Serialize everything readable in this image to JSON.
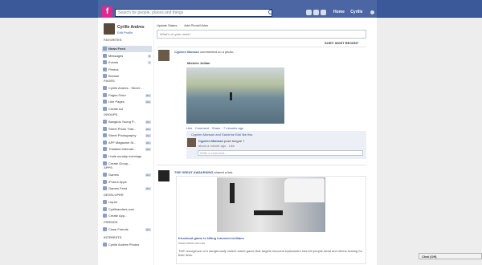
{
  "header": {
    "search_placeholder": "Search for people, places and things",
    "home": "Home",
    "user": "Cyrille"
  },
  "profile": {
    "name": "Cyrille Andres",
    "edit": "Edit Profile"
  },
  "sections": {
    "favorites": "FAVORITES",
    "pages": "PAGES",
    "groups": "GROUPS",
    "apps": "APPS",
    "developer": "DEVELOPER",
    "friends": "FRIENDS",
    "interests": "INTERESTS"
  },
  "favorites": [
    {
      "label": "News Feed",
      "badge": ""
    },
    {
      "label": "Messages",
      "badge": "9"
    },
    {
      "label": "Events",
      "badge": "7"
    },
    {
      "label": "Photos",
      "badge": ""
    },
    {
      "label": "Browse",
      "badge": ""
    }
  ],
  "pages": [
    {
      "label": "Cyrille Andres - Street ...",
      "badge": ""
    },
    {
      "label": "Pages Feed",
      "badge": "20+"
    },
    {
      "label": "Like Pages",
      "badge": "20+"
    },
    {
      "label": "Create Ad",
      "badge": ""
    }
  ],
  "groups": [
    {
      "label": "Bangkok Young P...",
      "badge": "20+"
    },
    {
      "label": "Street Photo Trail...",
      "badge": "20+"
    },
    {
      "label": "Street Photography",
      "badge": "20+"
    },
    {
      "label": "APF Magazine St...",
      "badge": "20+"
    },
    {
      "label": "Thailand Internati...",
      "badge": "20+"
    },
    {
      "label": "I hate sunday evenings",
      "badge": ""
    },
    {
      "label": "Create Group...",
      "badge": ""
    }
  ],
  "apps": [
    {
      "label": "Games",
      "badge": "20+"
    },
    {
      "label": "IFrame Apps",
      "badge": ""
    },
    {
      "label": "Games Feed",
      "badge": "20+"
    }
  ],
  "developer": [
    {
      "label": "Liquid",
      "badge": ""
    },
    {
      "label": "Cyrilleandres.com",
      "badge": ""
    },
    {
      "label": "Create App...",
      "badge": ""
    }
  ],
  "friends": [
    {
      "label": "Close Friends",
      "badge": "20+"
    }
  ],
  "interests": [
    {
      "label": "Cyrille Andres Photos",
      "badge": ""
    }
  ],
  "composer": {
    "tab_status": "Update Status",
    "tab_photo": "Add Photo/Video",
    "placeholder": "What's on your mind?"
  },
  "sort": "SORT: MOST RECENT",
  "post1": {
    "author": "Cyprien Mansan",
    "action": "commented on a photo.",
    "caption": "Michele Jullian",
    "actions": "Like · Comment · Share · 7 minutes ago",
    "likes": "Cyprien Mansan and Sandrine Bidi like this.",
    "comment_author": "Cyprien Mansan",
    "comment_text": "pose tongue ?",
    "comment_meta": "about a minute ago · Like",
    "comment_placeholder": "Write a comment..."
  },
  "post2": {
    "author": "THE GREAT AWAKENING",
    "action": "shared a link.",
    "link_title": "Knockout game is killing innocent civilians",
    "link_url": "www.news.com.au",
    "link_desc": "THE resurgence of a dangerously violent street game that targets innocent bystanders has left people dead and others fearing for their lives."
  },
  "chat": "Chat (Off)"
}
